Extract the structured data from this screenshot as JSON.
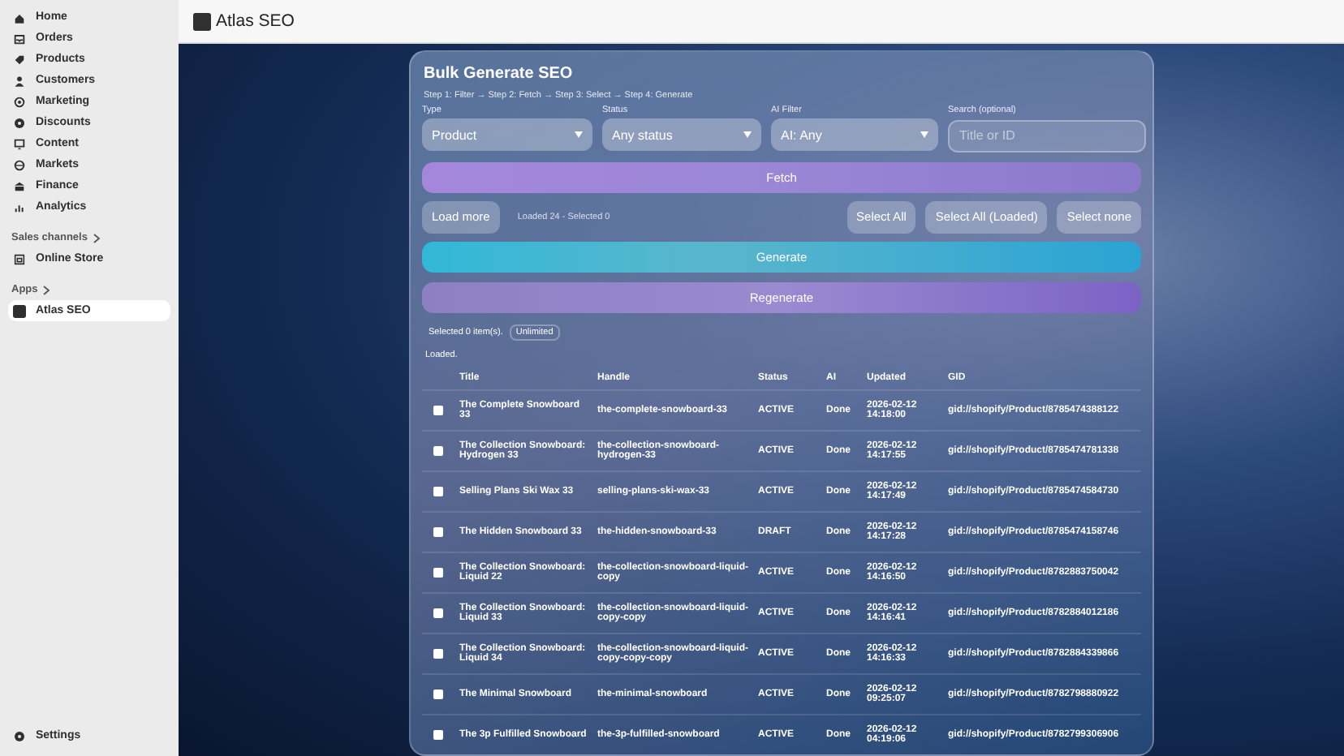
{
  "sidebar": {
    "items": [
      {
        "label": "Home",
        "selected": false
      },
      {
        "label": "Orders",
        "selected": false
      },
      {
        "label": "Products",
        "selected": false
      },
      {
        "label": "Customers",
        "selected": false
      },
      {
        "label": "Marketing",
        "selected": false
      },
      {
        "label": "Discounts",
        "selected": false
      },
      {
        "label": "Content",
        "selected": false
      },
      {
        "label": "Markets",
        "selected": false
      },
      {
        "label": "Finance",
        "selected": false
      },
      {
        "label": "Analytics",
        "selected": false
      }
    ],
    "sales_channels": {
      "heading": "Sales channels",
      "items": [
        {
          "label": "Online Store",
          "selected": false
        }
      ]
    },
    "apps": {
      "heading": "Apps",
      "items": [
        {
          "label": "Atlas SEO",
          "selected": true
        }
      ]
    },
    "settings": "Settings"
  },
  "header": {
    "title": "Atlas SEO"
  },
  "panel": {
    "title": "Bulk Generate SEO",
    "steps": "Step 1: Filter → Step 2: Fetch → Step 3: Select → Step 4: Generate",
    "filters": [
      {
        "label": "Type",
        "kind": "select",
        "value": "Product"
      },
      {
        "label": "Status",
        "kind": "select",
        "value": "Any status"
      },
      {
        "label": "AI Filter",
        "kind": "select",
        "value": "AI: Any"
      },
      {
        "label": "Search (optional)",
        "kind": "search",
        "placeholder": "Title or ID"
      }
    ],
    "fetch_button": "Fetch",
    "load_more_button": "Load more",
    "load_status": "Loaded 24 - Selected 0",
    "select_buttons": [
      "Select All",
      "Select All (Loaded)",
      "Select none"
    ],
    "generate_button": "Generate",
    "regenerate_button": "Regenerate",
    "selection_note": "Selected 0 item(s).",
    "plan_badge": "Unlimited",
    "status_message": "Loaded."
  },
  "table": {
    "columns": [
      "Title",
      "Handle",
      "Status",
      "AI",
      "Updated",
      "GID"
    ],
    "rows": [
      {
        "checked": false,
        "title": "The Complete Snowboard 33",
        "handle": "the-complete-snowboard-33",
        "status": "ACTIVE",
        "ai": "Done",
        "updated": "2026-02-12 14:18:00",
        "gid": "gid://shopify/Product/8785474388122"
      },
      {
        "checked": false,
        "title": "The Collection Snowboard: Hydrogen 33",
        "handle": "the-collection-snowboard-hydrogen-33",
        "status": "ACTIVE",
        "ai": "Done",
        "updated": "2026-02-12 14:17:55",
        "gid": "gid://shopify/Product/8785474781338"
      },
      {
        "checked": false,
        "title": "Selling Plans Ski Wax 33",
        "handle": "selling-plans-ski-wax-33",
        "status": "ACTIVE",
        "ai": "Done",
        "updated": "2026-02-12 14:17:49",
        "gid": "gid://shopify/Product/8785474584730"
      },
      {
        "checked": false,
        "title": "The Hidden Snowboard 33",
        "handle": "the-hidden-snowboard-33",
        "status": "DRAFT",
        "ai": "Done",
        "updated": "2026-02-12 14:17:28",
        "gid": "gid://shopify/Product/8785474158746"
      },
      {
        "checked": false,
        "title": "The Collection Snowboard: Liquid 22",
        "handle": "the-collection-snowboard-liquid-copy",
        "status": "ACTIVE",
        "ai": "Done",
        "updated": "2026-02-12 14:16:50",
        "gid": "gid://shopify/Product/8782883750042"
      },
      {
        "checked": false,
        "title": "The Collection Snowboard: Liquid 33",
        "handle": "the-collection-snowboard-liquid-copy-copy",
        "status": "ACTIVE",
        "ai": "Done",
        "updated": "2026-02-12 14:16:41",
        "gid": "gid://shopify/Product/8782884012186"
      },
      {
        "checked": false,
        "title": "The Collection Snowboard: Liquid 34",
        "handle": "the-collection-snowboard-liquid-copy-copy-copy",
        "status": "ACTIVE",
        "ai": "Done",
        "updated": "2026-02-12 14:16:33",
        "gid": "gid://shopify/Product/8782884339866"
      },
      {
        "checked": false,
        "title": "The Minimal Snowboard",
        "handle": "the-minimal-snowboard",
        "status": "ACTIVE",
        "ai": "Done",
        "updated": "2026-02-12 09:25:07",
        "gid": "gid://shopify/Product/8782798880922"
      },
      {
        "checked": false,
        "title": "The 3p Fulfilled Snowboard",
        "handle": "the-3p-fulfilled-snowboard",
        "status": "ACTIVE",
        "ai": "Done",
        "updated": "2026-02-12 04:19:06",
        "gid": "gid://shopify/Product/8782799306906"
      }
    ]
  }
}
